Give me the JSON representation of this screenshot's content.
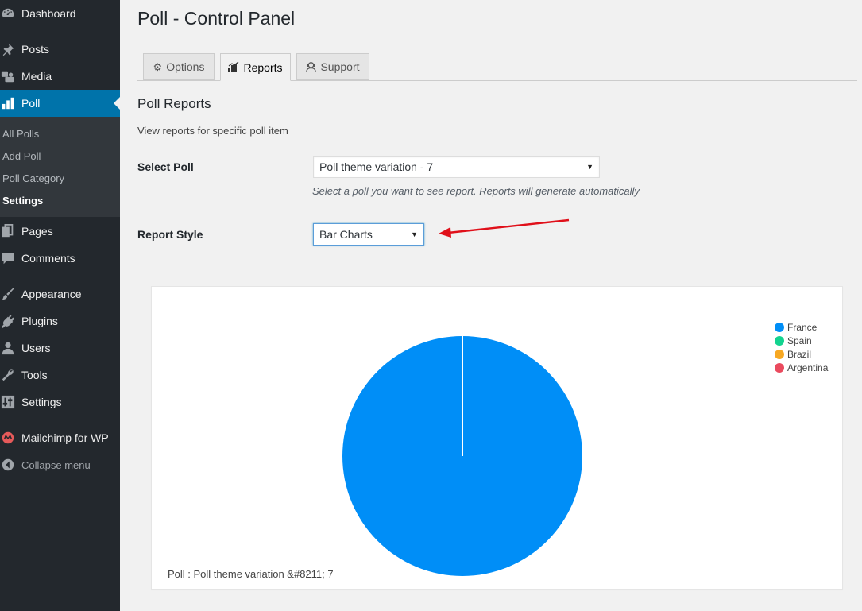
{
  "sidebar": {
    "items": [
      {
        "key": "dashboard",
        "label": "Dashboard",
        "icon": "dashboard-icon"
      },
      {
        "key": "posts",
        "label": "Posts",
        "icon": "pin-icon"
      },
      {
        "key": "media",
        "label": "Media",
        "icon": "media-icon"
      },
      {
        "key": "poll",
        "label": "Poll",
        "icon": "bar-chart-icon",
        "active": true
      },
      {
        "key": "pages",
        "label": "Pages",
        "icon": "pages-icon"
      },
      {
        "key": "comments",
        "label": "Comments",
        "icon": "comment-icon"
      },
      {
        "key": "appearance",
        "label": "Appearance",
        "icon": "brush-icon"
      },
      {
        "key": "plugins",
        "label": "Plugins",
        "icon": "plug-icon"
      },
      {
        "key": "users",
        "label": "Users",
        "icon": "user-icon"
      },
      {
        "key": "tools",
        "label": "Tools",
        "icon": "wrench-icon"
      },
      {
        "key": "settings",
        "label": "Settings",
        "icon": "settings-sliders-icon"
      },
      {
        "key": "mailchimp",
        "label": "Mailchimp for WP",
        "icon": "mailchimp-icon"
      }
    ],
    "submenu": [
      {
        "label": "All Polls"
      },
      {
        "label": "Add Poll"
      },
      {
        "label": "Poll Category"
      },
      {
        "label": "Settings",
        "current": true
      }
    ],
    "collapse_label": "Collapse menu"
  },
  "header": {
    "title": "Poll - Control Panel"
  },
  "tabs": [
    {
      "label": "Options",
      "icon": "gears-icon"
    },
    {
      "label": "Reports",
      "icon": "stats-icon",
      "active": true
    },
    {
      "label": "Support",
      "icon": "support-icon"
    }
  ],
  "reports": {
    "title": "Poll Reports",
    "description": "View reports for specific poll item",
    "select_poll": {
      "label": "Select Poll",
      "value": "Poll theme variation - 7",
      "help": "Select a poll you want to see report. Reports will generate automatically"
    },
    "report_style": {
      "label": "Report Style",
      "value": "Bar Charts"
    }
  },
  "colors": {
    "sidebar_bg": "#23282d",
    "active_blue": "#0073aa",
    "arrow_red": "#e0101a"
  },
  "chart_data": {
    "type": "pie",
    "categories": [
      "France",
      "Spain",
      "Brazil",
      "Argentina"
    ],
    "values": [
      100,
      0,
      0,
      0
    ],
    "colors": [
      "#008ef7",
      "#12d38f",
      "#f7a822",
      "#ea4a5e"
    ],
    "caption": "Poll : Poll theme variation &#8211; 7",
    "legend_position": "top-right"
  }
}
